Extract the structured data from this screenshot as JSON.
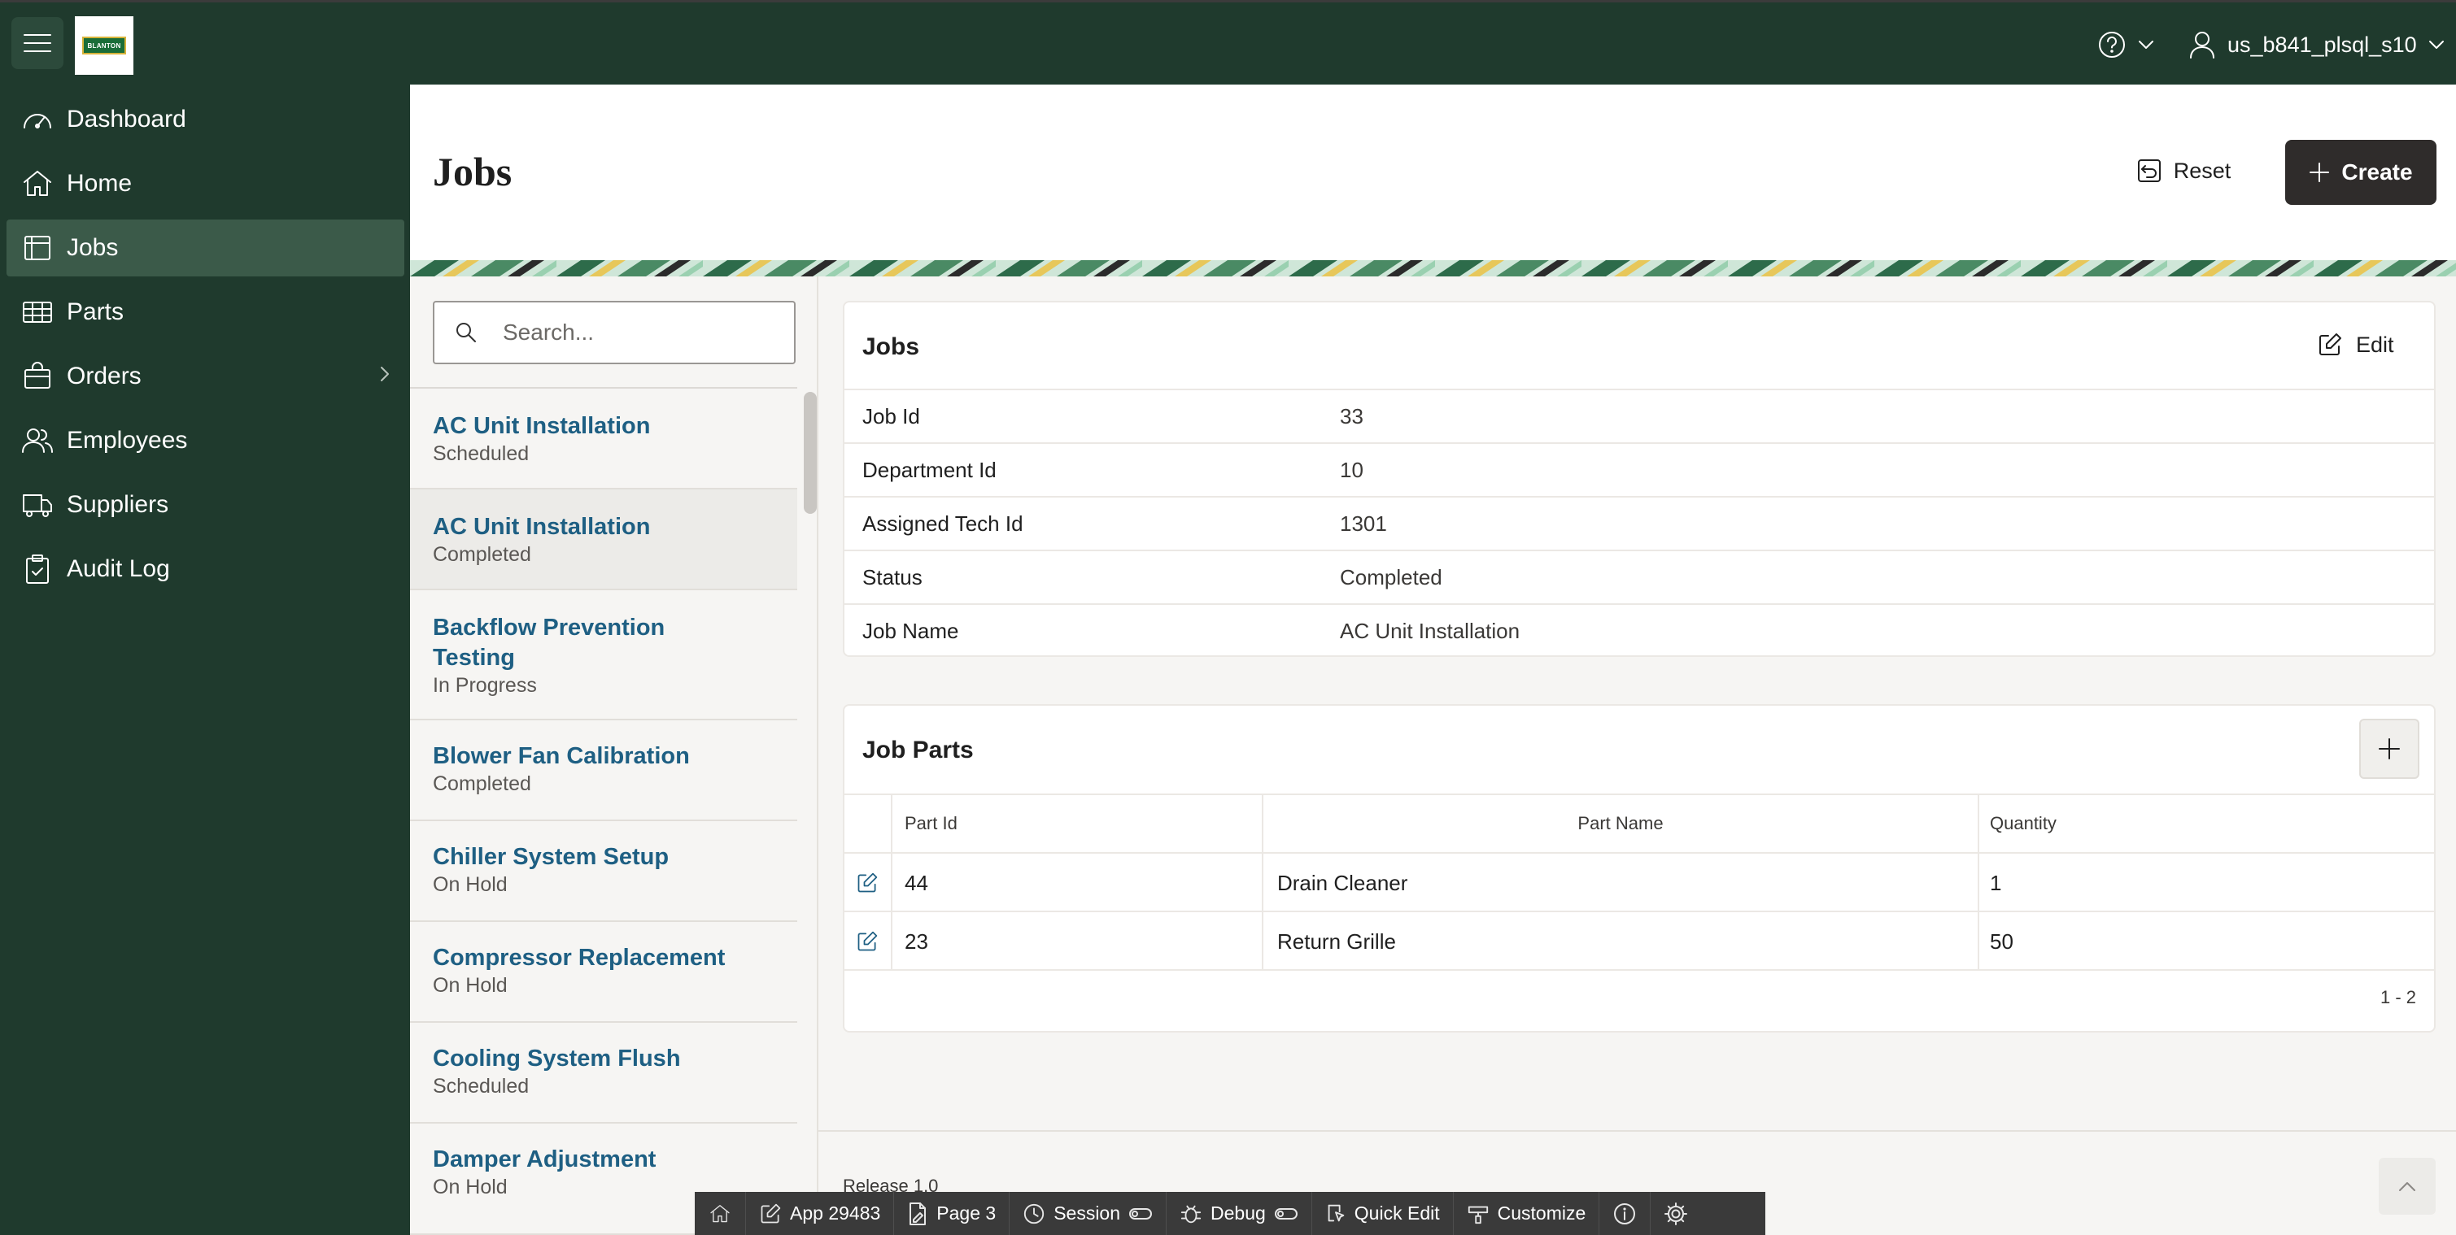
{
  "header": {
    "logo_text": "BLANTON",
    "user_name": "us_b841_plsql_s10"
  },
  "sidebar": {
    "items": [
      {
        "label": "Dashboard",
        "icon": "dashboard-icon"
      },
      {
        "label": "Home",
        "icon": "home-icon"
      },
      {
        "label": "Jobs",
        "icon": "table-icon",
        "active": true
      },
      {
        "label": "Parts",
        "icon": "grid-icon"
      },
      {
        "label": "Orders",
        "icon": "bag-icon",
        "expandable": true
      },
      {
        "label": "Employees",
        "icon": "users-icon"
      },
      {
        "label": "Suppliers",
        "icon": "truck-icon"
      },
      {
        "label": "Audit Log",
        "icon": "clipboard-icon"
      }
    ]
  },
  "page": {
    "title": "Jobs",
    "reset_label": "Reset",
    "create_label": "Create"
  },
  "search": {
    "placeholder": "Search..."
  },
  "job_list": [
    {
      "title": "AC Unit Installation",
      "status": "Scheduled"
    },
    {
      "title": "AC Unit Installation",
      "status": "Completed",
      "selected": true
    },
    {
      "title": "Backflow Prevention Testing",
      "status": "In Progress"
    },
    {
      "title": "Blower Fan Calibration",
      "status": "Completed"
    },
    {
      "title": "Chiller System Setup",
      "status": "On Hold"
    },
    {
      "title": "Compressor Replacement",
      "status": "On Hold"
    },
    {
      "title": "Cooling System Flush",
      "status": "Scheduled"
    },
    {
      "title": "Damper Adjustment",
      "status": "On Hold"
    }
  ],
  "job_detail": {
    "title": "Jobs",
    "edit_label": "Edit",
    "fields": [
      {
        "label": "Job Id",
        "value": "33"
      },
      {
        "label": "Department Id",
        "value": "10"
      },
      {
        "label": "Assigned Tech Id",
        "value": "1301"
      },
      {
        "label": "Status",
        "value": "Completed"
      },
      {
        "label": "Job Name",
        "value": "AC Unit Installation"
      }
    ]
  },
  "job_parts": {
    "title": "Job Parts",
    "columns": [
      "Part Id",
      "Part Name",
      "Quantity"
    ],
    "rows": [
      {
        "part_id": "44",
        "part_name": "Drain Cleaner",
        "quantity": "1"
      },
      {
        "part_id": "23",
        "part_name": "Return Grille",
        "quantity": "50"
      }
    ],
    "pagination": "1 - 2"
  },
  "footer": {
    "release": "Release 1.0"
  },
  "dev_toolbar": {
    "app": "App 29483",
    "page": "Page 3",
    "session": "Session",
    "debug": "Debug",
    "quick_edit": "Quick Edit",
    "customize": "Customize"
  },
  "colors": {
    "header_bg": "#1f3a2d",
    "sidebar_active": "#3b5a49",
    "link": "#1e5f83",
    "create_button": "#2f2c2b"
  }
}
